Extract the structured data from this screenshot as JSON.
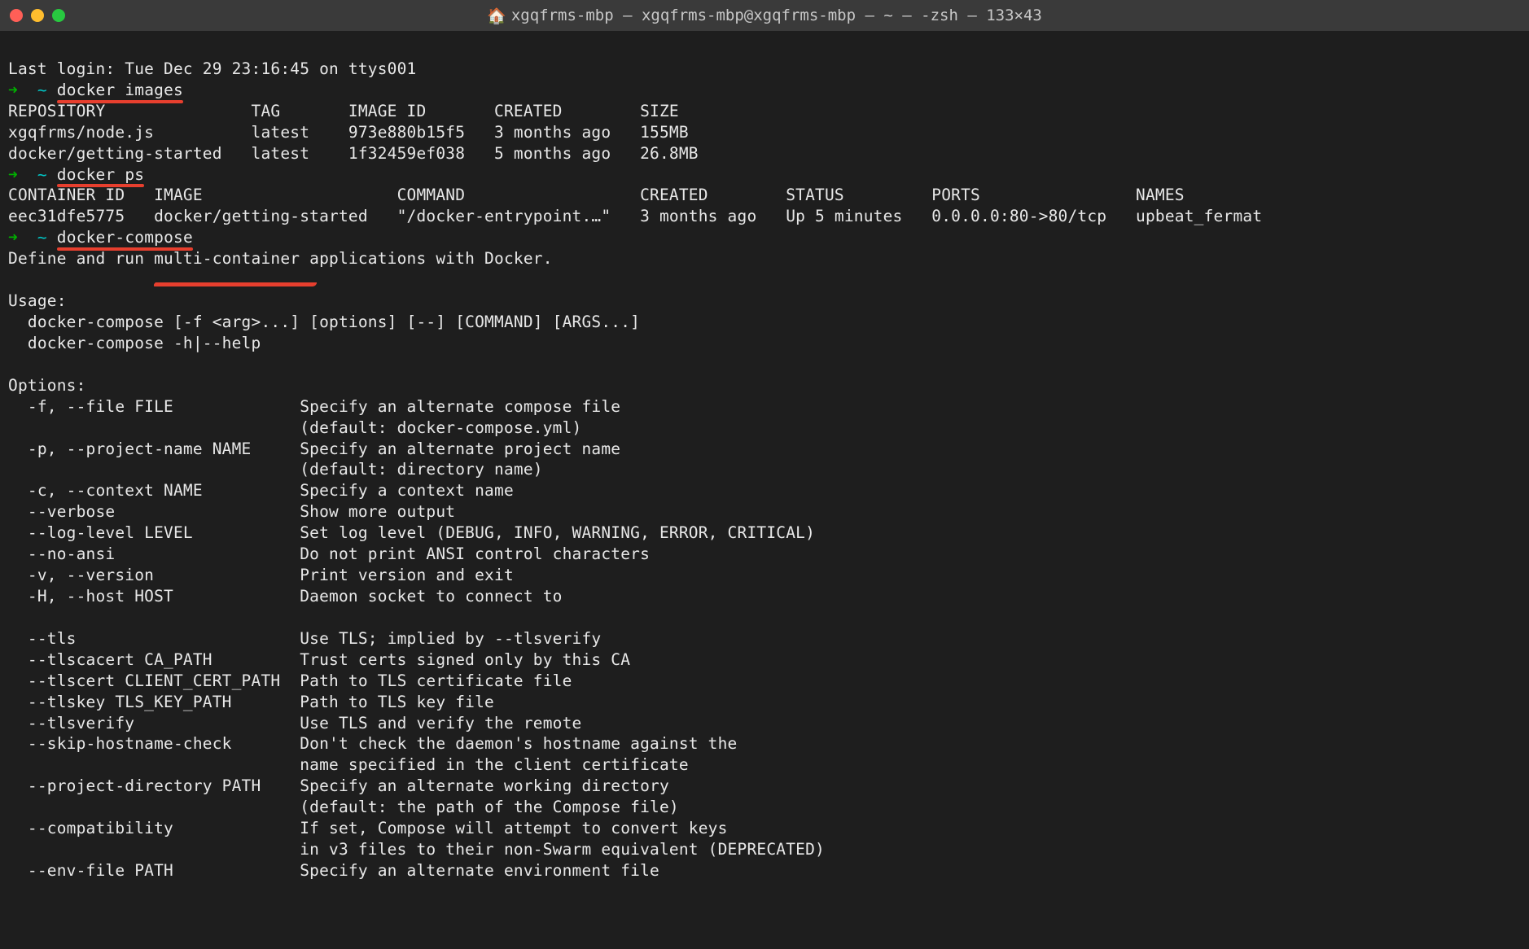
{
  "title_bar": {
    "home_icon": "🏠",
    "title": "xgqfrms-mbp — xgqfrms-mbp@xgqfrms-mbp — ~ — -zsh — 133×43"
  },
  "login_line": "Last login: Tue Dec 29 23:16:45 on ttys001",
  "prompt": {
    "arrow": "➜",
    "tilde": "~"
  },
  "cmd1": "docker images",
  "images_header": "REPOSITORY               TAG       IMAGE ID       CREATED        SIZE",
  "images_row1": "xgqfrms/node.js          latest    973e880b15f5   3 months ago   155MB",
  "images_row2": "docker/getting-started   latest    1f32459ef038   5 months ago   26.8MB",
  "cmd2": "docker ps",
  "ps_header": "CONTAINER ID   IMAGE                    COMMAND                  CREATED        STATUS         PORTS                NAMES",
  "ps_row1": "eec31dfe5775   docker/getting-started   \"/docker-entrypoint.…\"   3 months ago   Up 5 minutes   0.0.0.0:80->80/tcp   upbeat_fermat",
  "cmd3": "docker-compose",
  "compose_desc": "Define and run multi-container applications with Docker.",
  "usage_label": "Usage:",
  "usage_line1": "  docker-compose [-f <arg>...] [options] [--] [COMMAND] [ARGS...]",
  "usage_line2": "  docker-compose -h|--help",
  "options_label": "Options:",
  "opt_lines": [
    "  -f, --file FILE             Specify an alternate compose file",
    "                              (default: docker-compose.yml)",
    "  -p, --project-name NAME     Specify an alternate project name",
    "                              (default: directory name)",
    "  -c, --context NAME          Specify a context name",
    "  --verbose                   Show more output",
    "  --log-level LEVEL           Set log level (DEBUG, INFO, WARNING, ERROR, CRITICAL)",
    "  --no-ansi                   Do not print ANSI control characters",
    "  -v, --version               Print version and exit",
    "  -H, --host HOST             Daemon socket to connect to",
    "",
    "  --tls                       Use TLS; implied by --tlsverify",
    "  --tlscacert CA_PATH         Trust certs signed only by this CA",
    "  --tlscert CLIENT_CERT_PATH  Path to TLS certificate file",
    "  --tlskey TLS_KEY_PATH       Path to TLS key file",
    "  --tlsverify                 Use TLS and verify the remote",
    "  --skip-hostname-check       Don't check the daemon's hostname against the",
    "                              name specified in the client certificate",
    "  --project-directory PATH    Specify an alternate working directory",
    "                              (default: the path of the Compose file)",
    "  --compatibility             If set, Compose will attempt to convert keys",
    "                              in v3 files to their non-Swarm equivalent (DEPRECATED)",
    "  --env-file PATH             Specify an alternate environment file"
  ]
}
